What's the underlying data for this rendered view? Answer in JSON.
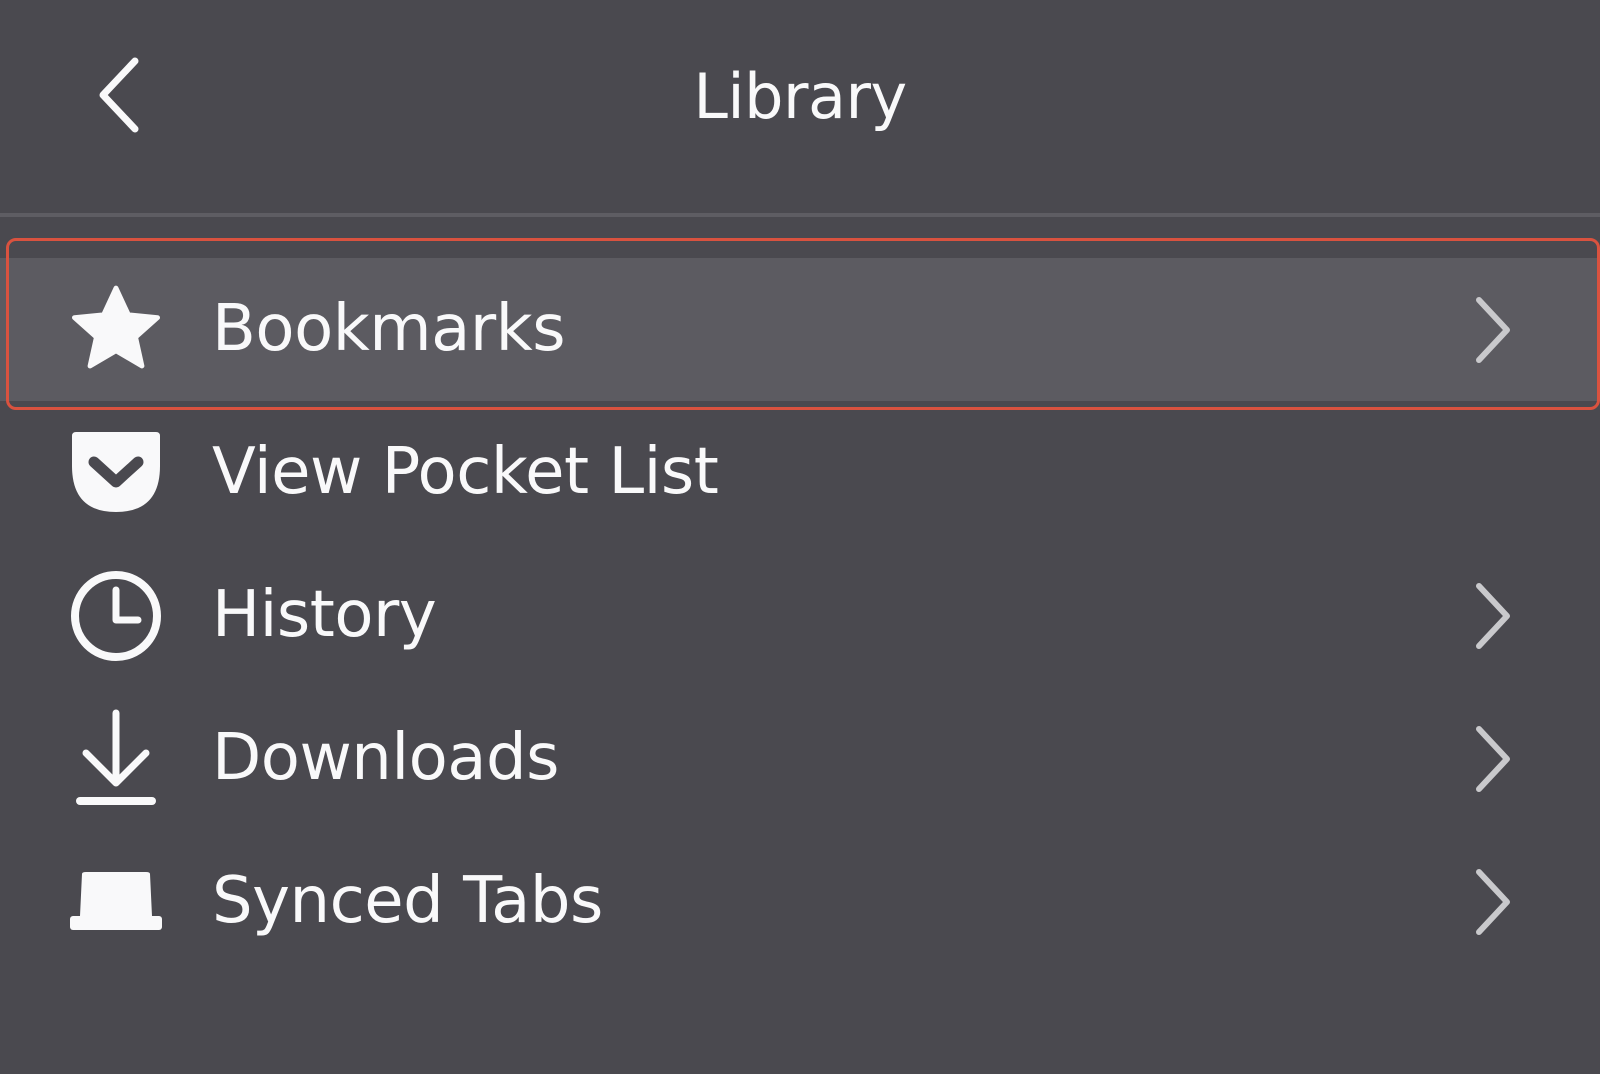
{
  "header": {
    "title": "Library",
    "back_icon": "chevron-left-icon"
  },
  "menu": {
    "items": [
      {
        "label": "Bookmarks",
        "icon": "star-icon",
        "has_submenu": true,
        "selected": true
      },
      {
        "label": "View Pocket List",
        "icon": "pocket-icon",
        "has_submenu": false,
        "selected": false
      },
      {
        "label": "History",
        "icon": "clock-icon",
        "has_submenu": true,
        "selected": false
      },
      {
        "label": "Downloads",
        "icon": "download-icon",
        "has_submenu": true,
        "selected": false
      },
      {
        "label": "Synced Tabs",
        "icon": "synced-tabs-icon",
        "has_submenu": true,
        "selected": false
      }
    ]
  },
  "colors": {
    "panel_background": "#4a494f",
    "selected_background": "#5c5b61",
    "text": "#f9f9fa",
    "highlight_border": "#d9523f"
  }
}
